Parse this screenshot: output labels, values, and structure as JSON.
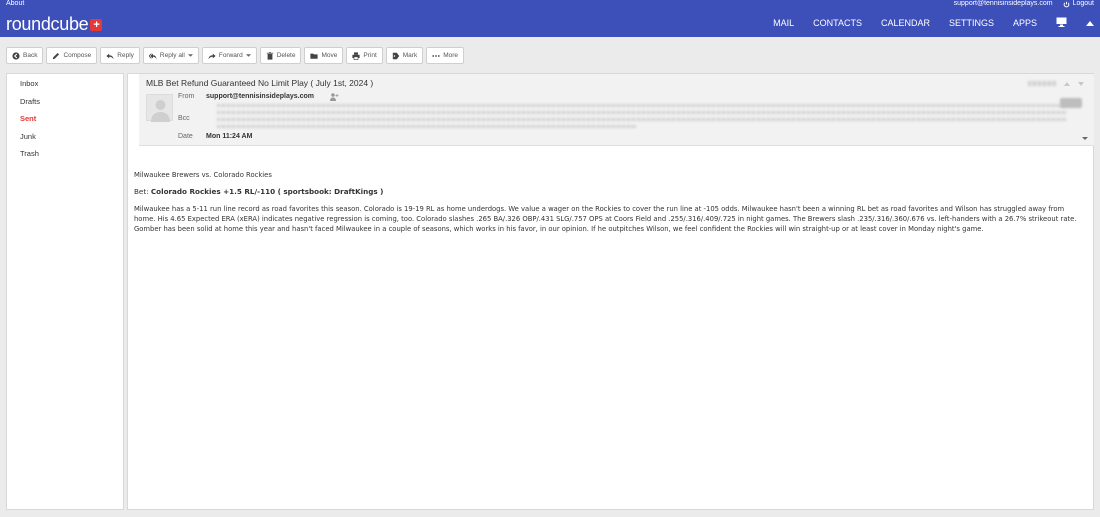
{
  "header": {
    "about": "About",
    "logo": "roundcube",
    "user_email": "support@tennisinsideplays.com",
    "logout": "Logout",
    "nav": [
      "MAIL",
      "CONTACTS",
      "CALENDAR",
      "SETTINGS",
      "APPS"
    ]
  },
  "toolbar": {
    "buttons": [
      {
        "label": "Back",
        "icon": "back-icon"
      },
      {
        "label": "Compose",
        "icon": "compose-icon"
      },
      {
        "label": "Reply",
        "icon": "reply-icon"
      },
      {
        "label": "Reply all",
        "icon": "reply-all-icon"
      },
      {
        "label": "Forward",
        "icon": "forward-icon"
      },
      {
        "label": "Delete",
        "icon": "delete-icon"
      },
      {
        "label": "Move",
        "icon": "move-icon"
      },
      {
        "label": "Print",
        "icon": "print-icon"
      },
      {
        "label": "Mark",
        "icon": "mark-icon"
      },
      {
        "label": "More",
        "icon": "more-icon"
      }
    ]
  },
  "folders": [
    {
      "label": "Inbox",
      "active": false
    },
    {
      "label": "Drafts",
      "active": false
    },
    {
      "label": "Sent",
      "active": true
    },
    {
      "label": "Junk",
      "active": false
    },
    {
      "label": "Trash",
      "active": false
    }
  ],
  "message": {
    "subject": "MLB Bet Refund Guaranteed No Limit Play ( July 1st, 2024 )",
    "from_label": "From",
    "from_value": "support@tennisinsideplays.com",
    "bcc_label": "Bcc",
    "date_label": "Date",
    "date_value": "Mon 11:24 AM",
    "body": {
      "matchup": "Milwaukee Brewers vs. Colorado Rockies",
      "bet_prefix": "Bet: ",
      "bet_value": "Colorado Rockies +1.5 RL/-110 ( sportsbook: DraftKings )",
      "paragraph": "Milwaukee has a 5-11 run line record as road favorites this season. Colorado is 19-19 RL as home underdogs. We value a wager on the Rockies to cover the run line at -105 odds. Milwaukee hasn't been a winning RL bet as road favorites and Wilson has struggled away from home. His 4.65 Expected ERA (xERA) indicates negative regression is coming, too. Colorado slashes .265 BA/.326 OBP/.431 SLG/.757 OPS at Coors Field and .255/.316/.409/.725 in night games. The Brewers slash .235/.316/.360/.676 vs. left-handers with a 26.7% strikeout rate. Gomber has been solid at home this year and hasn't faced Milwaukee in a couple of seasons, which works in his favor, in our opinion. If he outpitches Wilson, we feel confident the Rockies will win straight-up or at least cover in Monday night's game."
    }
  },
  "colors": {
    "header_bg": "#3d4fb8",
    "accent_red": "#e53838"
  }
}
